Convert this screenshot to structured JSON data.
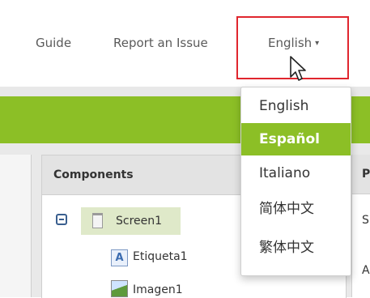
{
  "nav": {
    "guide": "Guide",
    "report": "Report an Issue",
    "language": "English",
    "caret": "▾"
  },
  "language_menu": {
    "items": [
      {
        "label": "English",
        "selected": false
      },
      {
        "label": "Español",
        "selected": true
      },
      {
        "label": "Italiano",
        "selected": false
      },
      {
        "label": "简体中文",
        "selected": false
      },
      {
        "label": "繁体中文",
        "selected": false
      }
    ]
  },
  "components": {
    "title": "Components",
    "screen": "Screen1",
    "label_icon": "A",
    "children": [
      "Etiqueta1",
      "Imagen1"
    ]
  },
  "properties": {
    "title": "P",
    "row1": "S",
    "row2": "A"
  },
  "colors": {
    "accent_green": "#8cbf26",
    "highlight_red": "#e0262e"
  },
  "icons": [
    "cursor-arrow-icon",
    "collapse-toggle-icon",
    "screen-icon",
    "label-component-icon",
    "image-component-icon"
  ]
}
